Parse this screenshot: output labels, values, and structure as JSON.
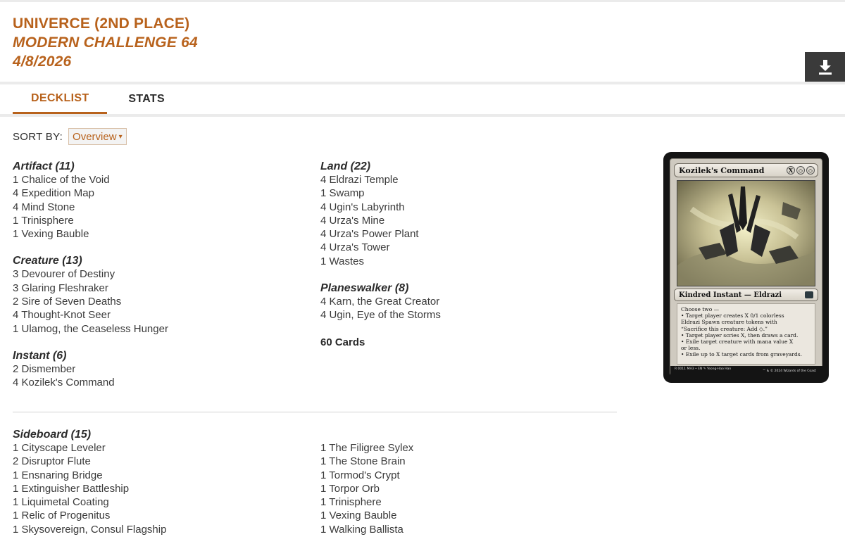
{
  "header": {
    "player": "UNIVERCE (2ND PLACE)",
    "event": "MODERN CHALLENGE 64",
    "date": "4/8/2026"
  },
  "download_icon": "download-icon",
  "tabs": [
    {
      "label": "DECKLIST",
      "active": true
    },
    {
      "label": "STATS",
      "active": false
    }
  ],
  "sort": {
    "label": "SORT BY:",
    "value": "Overview"
  },
  "mainboard": {
    "left": [
      {
        "title": "Artifact (11)",
        "cards": [
          "1 Chalice of the Void",
          "4 Expedition Map",
          "4 Mind Stone",
          "1 Trinisphere",
          "1 Vexing Bauble"
        ]
      },
      {
        "title": "Creature (13)",
        "cards": [
          "3 Devourer of Destiny",
          "3 Glaring Fleshraker",
          "2 Sire of Seven Deaths",
          "4 Thought-Knot Seer",
          "1 Ulamog, the Ceaseless Hunger"
        ]
      },
      {
        "title": "Instant (6)",
        "cards": [
          "2 Dismember",
          "4 Kozilek's Command"
        ]
      }
    ],
    "right": [
      {
        "title": "Land (22)",
        "cards": [
          "4 Eldrazi Temple",
          "1 Swamp",
          "4 Ugin's Labyrinth",
          "4 Urza's Mine",
          "4 Urza's Power Plant",
          "4 Urza's Tower",
          "1 Wastes"
        ]
      },
      {
        "title": "Planeswalker (8)",
        "cards": [
          "4 Karn, the Great Creator",
          "4 Ugin, Eye of the Storms"
        ]
      }
    ],
    "total": "60 Cards"
  },
  "sideboard": {
    "title": "Sideboard (15)",
    "left": [
      "1 Cityscape Leveler",
      "2 Disruptor Flute",
      "1 Ensnaring Bridge",
      "1 Extinguisher Battleship",
      "1 Liquimetal Coating",
      "1 Relic of Progenitus",
      "1 Skysovereign, Consul Flagship"
    ],
    "right": [
      "1 The Filigree Sylex",
      "1 The Stone Brain",
      "1 Tormod's Crypt",
      "1 Torpor Orb",
      "1 Trinisphere",
      "1 Vexing Bauble",
      "1 Walking Ballista"
    ]
  },
  "card_preview": {
    "name": "Kozilek's Command",
    "cost": [
      "X",
      "◇",
      "◇"
    ],
    "type_line": "Kindred Instant — Eldrazi",
    "rules_text": [
      "Choose two —",
      "• Target player creates X 0/1 colorless",
      "  Eldrazi Spawn creature tokens with",
      "  “Sacrifice this creature: Add ◇.”",
      "• Target player scries X, then draws a card.",
      "• Exile target creature with mana value X",
      "  or less.",
      "• Exile up to X target cards from graveyards."
    ],
    "footer_left": "R 0011  MH3 • EN  ✎ Yeong-Hao Han",
    "footer_right": "™ & © 2024 Wizards of the Coast",
    "colors": {
      "frame": "#cfcac0",
      "border": "#141414"
    }
  },
  "colors": {
    "accent": "#b8621c",
    "text": "#2b2b2b",
    "button_bg": "#3a3a3a"
  }
}
